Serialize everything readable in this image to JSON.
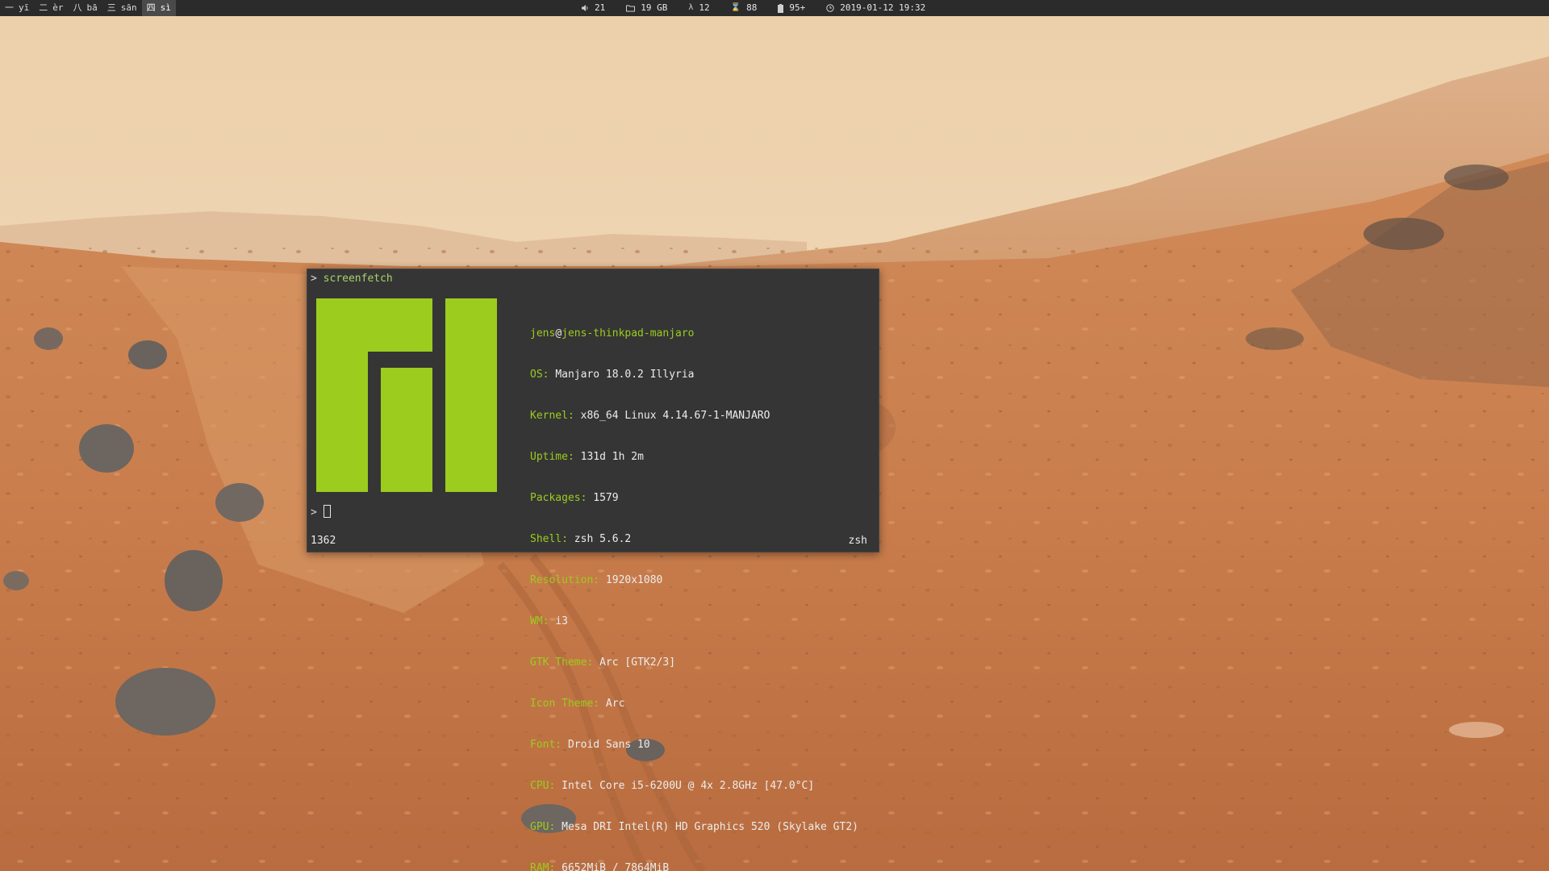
{
  "topbar": {
    "workspaces": [
      {
        "glyph": "一",
        "label": "yī",
        "active": false
      },
      {
        "glyph": "二",
        "label": "èr",
        "active": false
      },
      {
        "glyph": "八",
        "label": "bā",
        "active": false
      },
      {
        "glyph": "三",
        "label": "sān",
        "active": false
      },
      {
        "glyph": "四",
        "label": "sì",
        "active": true
      }
    ],
    "status": {
      "volume": "21",
      "disk": "19 GB",
      "lambda": "12",
      "sigma": "88",
      "battery": "95+",
      "datetime": "2019-01-12 19:32"
    }
  },
  "terminal": {
    "prompt_symbol": ">",
    "command": "screenfetch",
    "user": "jens",
    "at": "@",
    "host": "jens-thinkpad-manjaro",
    "info": [
      {
        "key": "OS:",
        "value": "Manjaro 18.0.2 Illyria"
      },
      {
        "key": "Kernel:",
        "value": "x86_64 Linux 4.14.67-1-MANJARO"
      },
      {
        "key": "Uptime:",
        "value": "131d 1h 2m"
      },
      {
        "key": "Packages:",
        "value": "1579"
      },
      {
        "key": "Shell:",
        "value": "zsh 5.6.2"
      },
      {
        "key": "Resolution:",
        "value": "1920x1080"
      },
      {
        "key": "WM:",
        "value": "i3"
      },
      {
        "key": "GTK Theme:",
        "value": "Arc [GTK2/3]"
      },
      {
        "key": "Icon Theme:",
        "value": "Arc"
      },
      {
        "key": "Font:",
        "value": "Droid Sans 10"
      },
      {
        "key": "CPU:",
        "value": "Intel Core i5-6200U @ 4x 2.8GHz [47.0°C]"
      },
      {
        "key": "GPU:",
        "value": "Mesa DRI Intel(R) HD Graphics 520 (Skylake GT2)"
      },
      {
        "key": "RAM:",
        "value": "6652MiB / 7864MiB"
      }
    ],
    "status_left": "1362",
    "status_right": "zsh"
  },
  "colors": {
    "manjaro_green": "#9ccc1e",
    "terminal_bg": "#353535",
    "bar_bg": "#2b2b2b"
  }
}
